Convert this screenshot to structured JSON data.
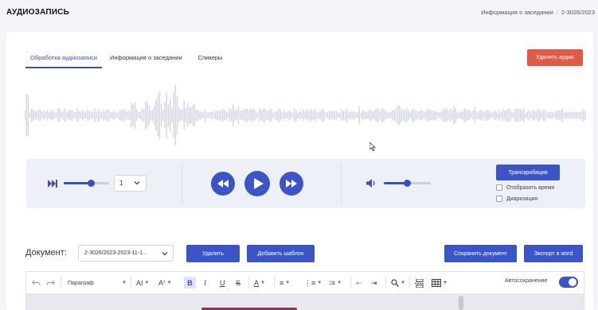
{
  "header": {
    "title": "АУДИОЗАПИСЬ",
    "breadcrumbs": [
      "Информация о заседании",
      "2-3026/2023"
    ]
  },
  "tabs": [
    {
      "label": "Обработка аудиозаписи",
      "active": true
    },
    {
      "label": "Информация о заседании",
      "active": false
    },
    {
      "label": "Спикеры",
      "active": false
    }
  ],
  "audio": {
    "delete_label": "Удалить аудио",
    "speed_value": "1",
    "speed_slider_level": 0.6,
    "volume_slider_level": 0.5
  },
  "transcription": {
    "button_label": "Транскрибация",
    "show_time_label": "Отобразить время",
    "diarization_label": "Диаризация",
    "show_time_checked": false,
    "diarization_checked": false
  },
  "document": {
    "label": "Документ:",
    "selected": "2-3026/2023-2023-11-1...",
    "delete_label": "Удалить",
    "add_template_label": "Добавить шаблон",
    "save_label": "Сохранить документ",
    "export_label": "Экспорт в word"
  },
  "editor": {
    "paragraph_label": "Параграф",
    "font_size_label": "AI",
    "font_style_label": "A",
    "autosave_label": "Автосохранение",
    "autosave_on": true
  },
  "colors": {
    "accent": "#3b55c8",
    "danger": "#e05a46",
    "waveform": "#d3d6e2"
  }
}
